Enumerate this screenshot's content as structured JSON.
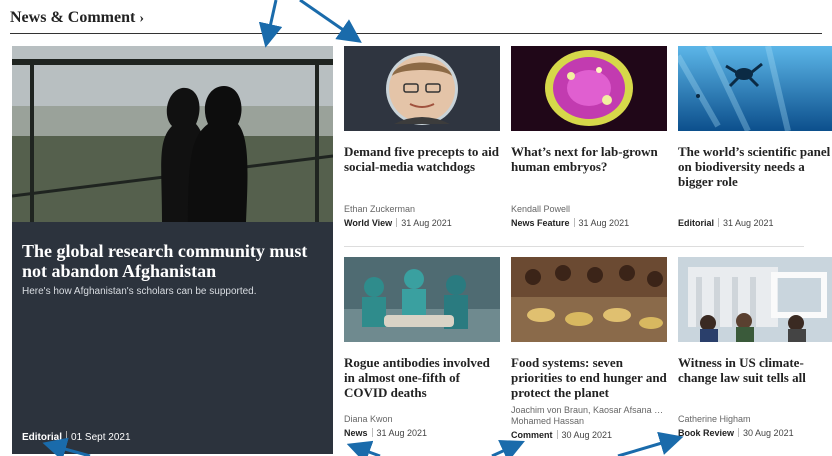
{
  "section": {
    "title": "News & Comment",
    "chevron": "›"
  },
  "lead": {
    "title": "The global research community must not abandon Afghanistan",
    "standfirst": "Here's how Afghanistan's scholars can be supported.",
    "type": "Editorial",
    "date": "01 Sept 2021"
  },
  "cards": [
    {
      "title": "Demand five precepts to aid social-media watchdogs",
      "author": "Ethan Zuckerman",
      "type": "World View",
      "date": "31 Aug 2021"
    },
    {
      "title": "What’s next for lab-grown human embryos?",
      "author": "Kendall Powell",
      "type": "News Feature",
      "date": "31 Aug 2021"
    },
    {
      "title": "The world’s scientific panel on biodiversity needs a bigger role",
      "author": "",
      "type": "Editorial",
      "date": "31 Aug 2021"
    },
    {
      "title": "Rogue antibodies involved in almost one-fifth of COVID deaths",
      "author": "Diana Kwon",
      "type": "News",
      "date": "31 Aug 2021"
    },
    {
      "title": "Food systems: seven priorities to end hunger and protect the planet",
      "author": "Joachim von Braun, Kaosar Afsana … Mohamed Hassan",
      "type": "Comment",
      "date": "30 Aug 2021"
    },
    {
      "title": "Witness in US climate-change law suit tells all",
      "author": "Catherine Higham",
      "type": "Book Review",
      "date": "30 Aug 2021"
    }
  ],
  "colors": {
    "lead_bg": "#2c333d",
    "arrow": "#1a6bab"
  }
}
